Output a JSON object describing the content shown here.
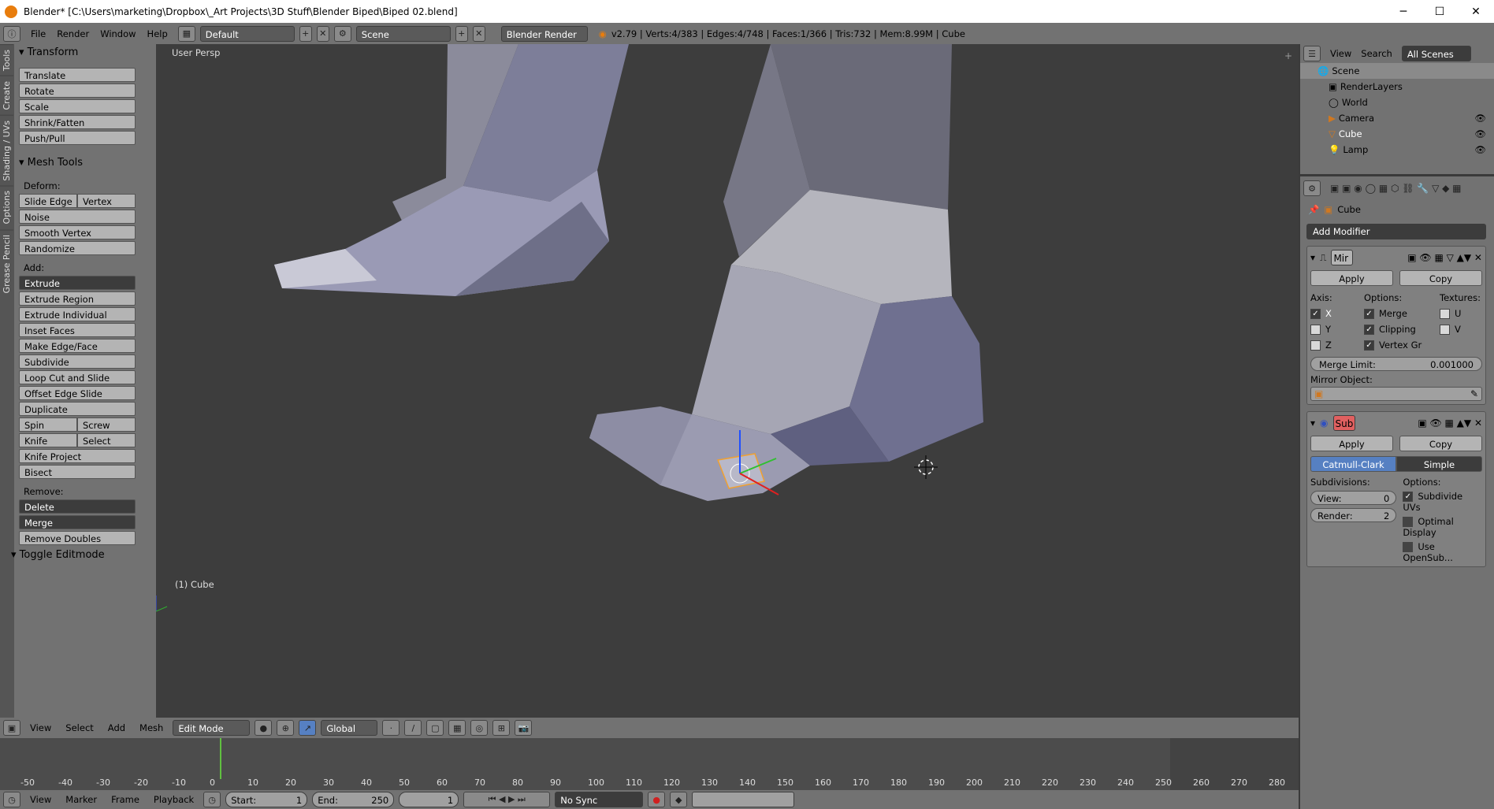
{
  "window": {
    "title": "Blender* [C:\\Users\\marketing\\Dropbox\\_Art Projects\\3D Stuff\\Blender Biped\\Biped 02.blend]",
    "minimize": "─",
    "maximize": "☐",
    "close": "✕"
  },
  "info": {
    "menus": [
      "File",
      "Render",
      "Window",
      "Help"
    ],
    "layout": "Default",
    "scene": "Scene",
    "engine": "Blender Render",
    "stats": "v2.79 | Verts:4/383 | Edges:4/748 | Faces:1/366 | Tris:732 | Mem:8.99M | Cube"
  },
  "tabs": [
    "Tools",
    "Create",
    "Shading / UVs",
    "Options",
    "Grease Pencil"
  ],
  "toolshelf": {
    "transform": {
      "title": "Transform",
      "buttons": [
        "Translate",
        "Rotate",
        "Scale",
        "Shrink/Fatten",
        "Push/Pull"
      ]
    },
    "meshtools": {
      "title": "Mesh Tools",
      "deform_label": "Deform:",
      "slide_edge": "Slide Edge",
      "vertex": "Vertex",
      "noise": "Noise",
      "smooth_vertex": "Smooth Vertex",
      "randomize": "Randomize",
      "add_label": "Add:",
      "extrude": "Extrude",
      "add_buttons": [
        "Extrude Region",
        "Extrude Individual",
        "Inset Faces",
        "Make Edge/Face",
        "Subdivide",
        "Loop Cut and Slide",
        "Offset Edge Slide",
        "Duplicate"
      ],
      "spin": "Spin",
      "screw": "Screw",
      "knife": "Knife",
      "select": "Select",
      "knife_project": "Knife Project",
      "bisect": "Bisect",
      "remove_label": "Remove:",
      "delete": "Delete",
      "merge": "Merge",
      "remove_doubles": "Remove Doubles"
    },
    "toggle_editmode": "Toggle Editmode"
  },
  "viewport": {
    "view_name": "User Persp",
    "object_name": "(1) Cube"
  },
  "outliner": {
    "view": "View",
    "search": "Search",
    "all_scenes": "All Scenes",
    "items": [
      "Scene",
      "RenderLayers",
      "World",
      "Camera",
      "Cube",
      "Lamp"
    ]
  },
  "properties": {
    "object": "Cube",
    "add_modifier": "Add Modifier",
    "mirror": {
      "name": "Mir",
      "apply": "Apply",
      "copy": "Copy",
      "axis_label": "Axis:",
      "options_label": "Options:",
      "textures_label": "Textures:",
      "x": "X",
      "y": "Y",
      "z": "Z",
      "merge": "Merge",
      "clipping": "Clipping",
      "vertex_gr": "Vertex Gr",
      "u": "U",
      "v": "V",
      "merge_limit_label": "Merge Limit:",
      "merge_limit": "0.001000",
      "mirror_object": "Mirror Object:"
    },
    "subsurf": {
      "name": "Sub",
      "apply": "Apply",
      "copy": "Copy",
      "catmull": "Catmull-Clark",
      "simple": "Simple",
      "subdivisions": "Subdivisions:",
      "options": "Options:",
      "view_label": "View:",
      "view_val": "0",
      "render_label": "Render:",
      "render_val": "2",
      "subdivide_uvs": "Subdivide UVs",
      "optimal_display": "Optimal Display",
      "use_opensub": "Use OpenSub..."
    }
  },
  "vheader": {
    "menus": [
      "View",
      "Select",
      "Add",
      "Mesh"
    ],
    "mode": "Edit Mode",
    "orientation": "Global"
  },
  "timeline": {
    "ticks": [
      "-50",
      "-40",
      "-30",
      "-20",
      "-10",
      "0",
      "10",
      "20",
      "30",
      "40",
      "50",
      "60",
      "70",
      "80",
      "90",
      "100",
      "110",
      "120",
      "130",
      "140",
      "150",
      "160",
      "170",
      "180",
      "190",
      "200",
      "210",
      "220",
      "230",
      "240",
      "250",
      "260",
      "270",
      "280"
    ],
    "current_frame": 1
  },
  "tlheader": {
    "menus": [
      "View",
      "Marker",
      "Frame",
      "Playback"
    ],
    "start_label": "Start:",
    "start": "1",
    "end_label": "End:",
    "end": "250",
    "frame": "1",
    "sync": "No Sync"
  }
}
